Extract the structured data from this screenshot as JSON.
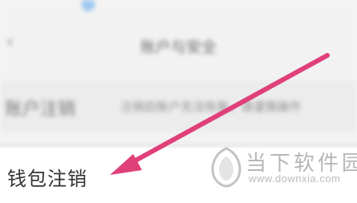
{
  "nav": {
    "back_icon": "chevron-left-icon",
    "title": "账户与安全"
  },
  "rows": {
    "delete_account": {
      "label": "账户注销",
      "description": "注销后账户无法恢复，请谨慎操作"
    },
    "wallet_delete": {
      "label": "钱包注销"
    }
  },
  "watermark": {
    "name": "当下软件园",
    "url": "www.downxia.com"
  },
  "annotation": {
    "arrow_color": "#e0407a"
  }
}
